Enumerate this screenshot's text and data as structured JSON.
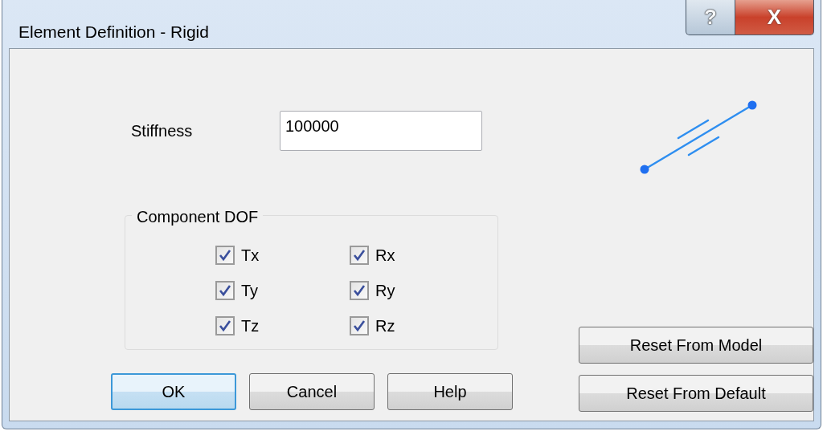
{
  "window": {
    "title": "Element Definition - Rigid",
    "help_button": "?",
    "close_button": "X"
  },
  "stiffness": {
    "label": "Stiffness",
    "value": "100000"
  },
  "component_dof": {
    "title": "Component DOF",
    "items": [
      {
        "label": "Tx",
        "checked": true
      },
      {
        "label": "Rx",
        "checked": true
      },
      {
        "label": "Ty",
        "checked": true
      },
      {
        "label": "Ry",
        "checked": true
      },
      {
        "label": "Tz",
        "checked": true
      },
      {
        "label": "Rz",
        "checked": true
      }
    ]
  },
  "side_buttons": [
    "Reset From Model",
    "Reset From Default"
  ],
  "buttons": [
    {
      "label": "OK",
      "default": true
    },
    {
      "label": "Cancel",
      "default": false
    },
    {
      "label": "Help",
      "default": false
    }
  ]
}
